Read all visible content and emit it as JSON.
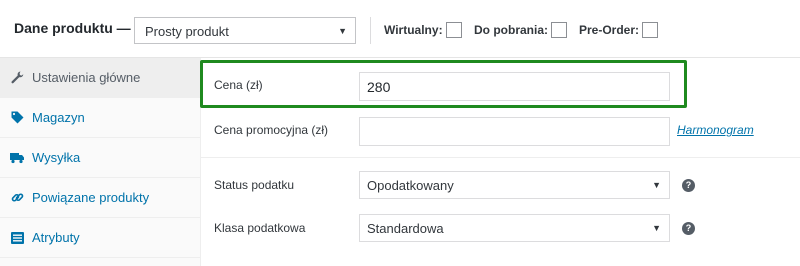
{
  "header": {
    "title": "Dane produktu —",
    "product_type": "Prosty produkt",
    "options": [
      {
        "label": "Wirtualny:"
      },
      {
        "label": "Do pobrania:"
      },
      {
        "label": "Pre-Order:"
      }
    ]
  },
  "sidebar": {
    "items": [
      {
        "label": "Ustawienia główne",
        "icon": "wrench-icon"
      },
      {
        "label": "Magazyn",
        "icon": "tag-icon"
      },
      {
        "label": "Wysyłka",
        "icon": "truck-icon"
      },
      {
        "label": "Powiązane produkty",
        "icon": "link-icon"
      },
      {
        "label": "Atrybuty",
        "icon": "list-icon"
      }
    ]
  },
  "general": {
    "price_label": "Cena (zł)",
    "price_value": "280",
    "sale_price_label": "Cena promocyjna (zł)",
    "sale_price_value": "",
    "schedule_link": "Harmonogram",
    "tax_status_label": "Status podatku",
    "tax_status_value": "Opodatkowany",
    "tax_class_label": "Klasa podatkowa",
    "tax_class_value": "Standardowa"
  },
  "colors": {
    "highlight": "#1f8a1f",
    "link": "#0073aa"
  }
}
